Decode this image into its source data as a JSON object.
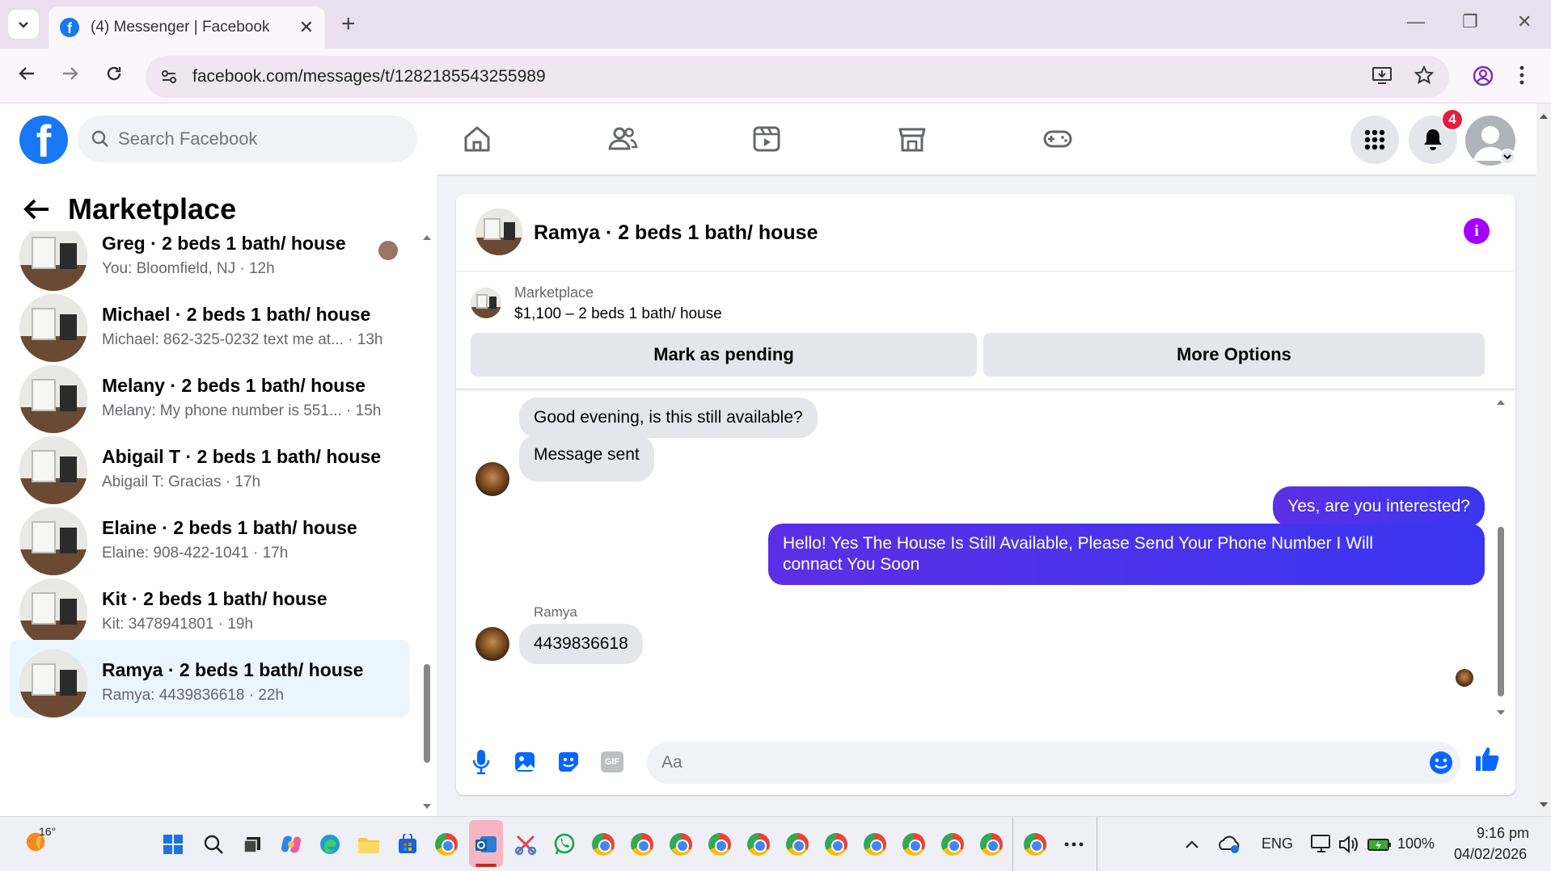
{
  "browser": {
    "tab_title": "(4) Messenger | Facebook",
    "tab_close": "✕",
    "new_tab": "+",
    "url": "facebook.com/messages/t/1282185543255989",
    "window_controls": [
      "—",
      "❐",
      "✕"
    ]
  },
  "fb": {
    "logo_letter": "f",
    "search_placeholder": "Search Facebook",
    "nav_icons": [
      "home-icon",
      "friends-icon",
      "video-icon",
      "marketplace-icon",
      "gaming-icon"
    ],
    "notification_count": "4",
    "colors": {
      "brand": "#1877f2",
      "outgoing": "#4a2fe8",
      "info": "#a400ff",
      "badge": "#e41e3f"
    }
  },
  "left_panel": {
    "title": "Marketplace",
    "conversations": [
      {
        "name": "Greg · 2 beds 1 bath/ house",
        "snippet": "You: Bloomfield, NJ · 12h"
      },
      {
        "name": "Michael · 2 beds 1 bath/ house",
        "snippet": "Michael: 862-325-0232 text me at... · 13h"
      },
      {
        "name": "Melany · 2 beds 1 bath/ house",
        "snippet": "Melany: My phone number is 551... · 15h"
      },
      {
        "name": "Abigail T · 2 beds 1 bath/ house",
        "snippet": "Abigail T: Gracias · 17h"
      },
      {
        "name": "Elaine · 2 beds 1 bath/ house",
        "snippet": "Elaine: 908-422-1041 · 17h"
      },
      {
        "name": "Kit · 2 beds 1 bath/ house",
        "snippet": "Kit: 3478941801 · 19h"
      },
      {
        "name": "Ramya · 2 beds 1 bath/ house",
        "snippet": "Ramya: 4439836618 · 22h"
      }
    ]
  },
  "chat": {
    "title": "Ramya · 2 beds 1 bath/ house",
    "info_glyph": "i",
    "marketplace_label": "Marketplace",
    "listing": "$1,100 – 2 beds 1 bath/ house",
    "mark_pending": "Mark as pending",
    "more_options": "More Options",
    "messages": [
      {
        "text": "Good evening, is this still available?",
        "from": "Ramya"
      },
      {
        "text": "Message sent",
        "from": "Ramya"
      },
      {
        "text": "Yes, are you interested?",
        "from": "me"
      },
      {
        "line1": "Hello! Yes The House  Is Still Available, Please Send Your Phone Number I Will",
        "line2": "connact You Soon",
        "from": "me"
      },
      {
        "sender": "Ramya",
        "text": "4439836618",
        "from": "Ramya"
      }
    ],
    "composer_placeholder": "Aa",
    "composer_icons": [
      "microphone-icon",
      "photo-icon",
      "sticker-icon",
      "gif-icon",
      "emoji-icon",
      "like-icon"
    ],
    "gif_label": "GIF"
  },
  "taskbar": {
    "weather": "16°",
    "tray": {
      "lang": "ENG",
      "battery": "100%",
      "time": "9:16 pm",
      "date": "04/02/2026"
    }
  }
}
